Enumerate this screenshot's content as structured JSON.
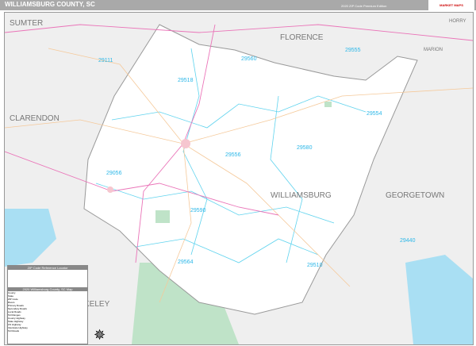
{
  "header": {
    "title": "WILLIAMSBURG COUNTY, SC",
    "edition": "2020 ZIP Code Premium Edition",
    "logo": "Market MAPS"
  },
  "counties": [
    "SUMTER",
    "FLORENCE",
    "HORRY",
    "MARION",
    "CLARENDON",
    "WILLIAMSBURG",
    "GEORGETOWN",
    "KELEY"
  ],
  "zips": [
    "29111",
    "29560",
    "29555",
    "29518",
    "29554",
    "29556",
    "29580",
    "29056",
    "29590",
    "29564",
    "29510",
    "29440"
  ],
  "legend": {
    "table_title": "ZIP Code Reference Locator",
    "map_title": "2020 Williamsburg County, SC Map",
    "rows": [
      "County",
      "State",
      "ZIP Code",
      "Rivers",
      "Primary Roads",
      "Secondary Roads",
      "Local Roads",
      "Toll Ranges",
      "County Highway",
      "State Highway",
      "US Highway",
      "Interstate Highway",
      "Toll Roads"
    ]
  },
  "colors": {
    "county_fill": "#ffffff",
    "outside": "#efefef",
    "zip_lines": "#5fd3ee",
    "water": "#a9dff3",
    "forest": "#bfe3c8"
  }
}
